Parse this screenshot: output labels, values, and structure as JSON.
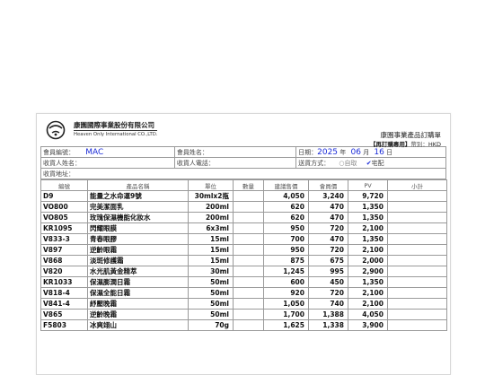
{
  "company": {
    "name_zh": "康園國際事業股份有限公司",
    "name_en": "Heaven Only International CO.,LTD."
  },
  "form": {
    "title": "康園事業產品訂購單",
    "subtitle_tag": "【再訂購專用】",
    "category_label": "幣別：",
    "category_value": "HKD"
  },
  "member": {
    "id_label": "會員編號：",
    "id_value": "MAC",
    "name_label": "會員姓名：",
    "date_label": "日期：",
    "year": "2025",
    "year_unit": "年",
    "month": "06",
    "month_unit": "月",
    "day": "16",
    "day_unit": "日"
  },
  "recipient": {
    "name_label": "收貨人姓名：",
    "phone_label": "收貨人電話：",
    "delivery_label": "送貨方式：",
    "option_pickup_mark": "○",
    "option_pickup": "自取",
    "option_home_mark": "✔",
    "option_home": "宅配",
    "address_label": "收貨地址："
  },
  "table": {
    "headers": [
      "編號",
      "產品名稱",
      "單位",
      "數量",
      "建議售價",
      "會員價",
      "PV",
      "小計"
    ],
    "rows": [
      {
        "code": "D9",
        "name": "能量之水命運9號",
        "unit": "30mlx2瓶",
        "qty": "",
        "price": "4,050",
        "member": "3,240",
        "pv": "9,720",
        "sub": ""
      },
      {
        "code": "VO800",
        "name": "完美潔面乳",
        "unit": "200ml",
        "qty": "",
        "price": "620",
        "member": "470",
        "pv": "1,350",
        "sub": ""
      },
      {
        "code": "VO805",
        "name": "玫瑰保濕機能化妝水",
        "unit": "200ml",
        "qty": "",
        "price": "620",
        "member": "470",
        "pv": "1,350",
        "sub": ""
      },
      {
        "code": "KR1095",
        "name": "閃耀眼膜",
        "unit": "6x3ml",
        "qty": "",
        "price": "950",
        "member": "720",
        "pv": "2,100",
        "sub": ""
      },
      {
        "code": "V833-3",
        "name": "青春眼膠",
        "unit": "15ml",
        "qty": "",
        "price": "700",
        "member": "470",
        "pv": "1,350",
        "sub": ""
      },
      {
        "code": "V897",
        "name": "逆齡眼霜",
        "unit": "15ml",
        "qty": "",
        "price": "950",
        "member": "720",
        "pv": "2,100",
        "sub": ""
      },
      {
        "code": "V868",
        "name": "淡斑修護霜",
        "unit": "15ml",
        "qty": "",
        "price": "875",
        "member": "675",
        "pv": "2,000",
        "sub": ""
      },
      {
        "code": "V820",
        "name": "水光肌黃金精萃",
        "unit": "30ml",
        "qty": "",
        "price": "1,245",
        "member": "995",
        "pv": "2,900",
        "sub": ""
      },
      {
        "code": "KR1033",
        "name": "保濕膨潤日霜",
        "unit": "50ml",
        "qty": "",
        "price": "600",
        "member": "450",
        "pv": "1,350",
        "sub": ""
      },
      {
        "code": "V818-4",
        "name": "保濕全能日霜",
        "unit": "50ml",
        "qty": "",
        "price": "920",
        "member": "720",
        "pv": "2,100",
        "sub": ""
      },
      {
        "code": "V841-4",
        "name": "紓壓晚霜",
        "unit": "50ml",
        "qty": "",
        "price": "1,050",
        "member": "740",
        "pv": "2,100",
        "sub": ""
      },
      {
        "code": "V865",
        "name": "逆齡晚霜",
        "unit": "50ml",
        "qty": "",
        "price": "1,700",
        "member": "1,388",
        "pv": "4,050",
        "sub": ""
      },
      {
        "code": "F5803",
        "name": "冰爽翊山",
        "unit": "70g",
        "qty": "",
        "price": "1,625",
        "member": "1,338",
        "pv": "3,900",
        "sub": ""
      }
    ]
  }
}
